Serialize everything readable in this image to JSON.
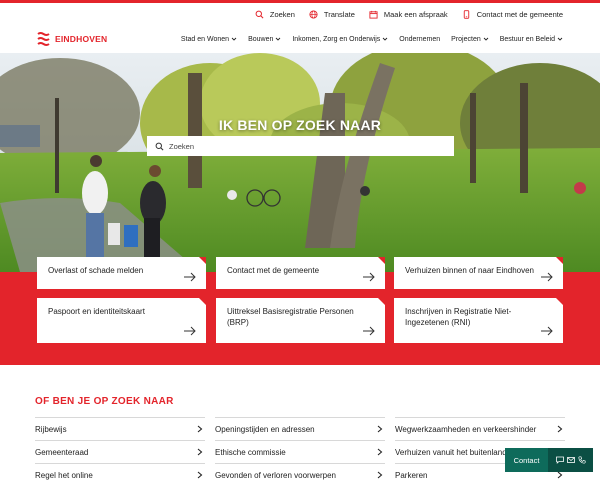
{
  "utility": {
    "search": "Zoeken",
    "translate": "Translate",
    "appointment": "Maak een afspraak",
    "contact": "Contact met de gemeente"
  },
  "logo": {
    "text": "EINDHOVEN"
  },
  "nav": [
    {
      "label": "Stad en Wonen",
      "dropdown": true
    },
    {
      "label": "Bouwen",
      "dropdown": true
    },
    {
      "label": "Inkomen, Zorg en Onderwijs",
      "dropdown": true
    },
    {
      "label": "Ondernemen",
      "dropdown": false
    },
    {
      "label": "Projecten",
      "dropdown": true
    },
    {
      "label": "Bestuur en Beleid",
      "dropdown": true
    }
  ],
  "hero": {
    "title": "IK BEN OP ZOEK NAAR",
    "search_placeholder": "Zoeken"
  },
  "cards": [
    {
      "label": "Overlast of schade melden"
    },
    {
      "label": "Contact met de gemeente"
    },
    {
      "label": "Verhuizen binnen of naar Eindhoven"
    },
    {
      "label": "Paspoort en identiteitskaart"
    },
    {
      "label": "Uittreksel Basisregistratie Personen (BRP)"
    },
    {
      "label": "Inschrijven in Registratie Niet-Ingezetenen (RNI)"
    }
  ],
  "section2": {
    "title": "OF BEN JE OP ZOEK NAAR",
    "col1": [
      "Rijbewijs",
      "Gemeenteraad",
      "Regel het online"
    ],
    "col2": [
      "Openingstijden en adressen",
      "Ethische commissie",
      "Gevonden of verloren voorwerpen"
    ],
    "col3": [
      "Wegwerkzaamheden en verkeershinder",
      "Verhuizen vanuit het buitenland",
      "Parkeren"
    ]
  },
  "contact_widget": {
    "label": "Contact"
  },
  "colors": {
    "brand_red": "#e3242b",
    "contact_green": "#0e6b5b"
  }
}
